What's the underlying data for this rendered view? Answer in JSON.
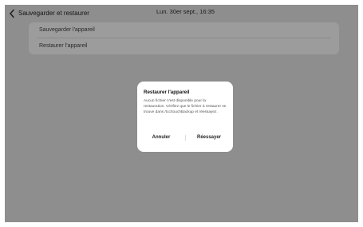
{
  "header": {
    "back_icon": "chevron-left-icon",
    "title": "Sauvegarder et restaurer",
    "datetime": "Lun. 30er sept., 16:35"
  },
  "menu": {
    "items": [
      {
        "label": "Sauvegarder l'appareil"
      },
      {
        "label": "Restaurer l'appareil"
      }
    ]
  },
  "dialog": {
    "title": "Restaurer l'appareil",
    "message": "Aucun fichier n'est disponible pour la restauration. Vérifiez que le fichier à restaurer se trouve dans /tcc/touchBackup et réessayez.",
    "cancel_label": "Annuler",
    "retry_label": "Réessayer"
  },
  "colors": {
    "dim_overlay": "#8e8e8e",
    "card": "#9c9c9c",
    "dialog": "#ffffff"
  }
}
